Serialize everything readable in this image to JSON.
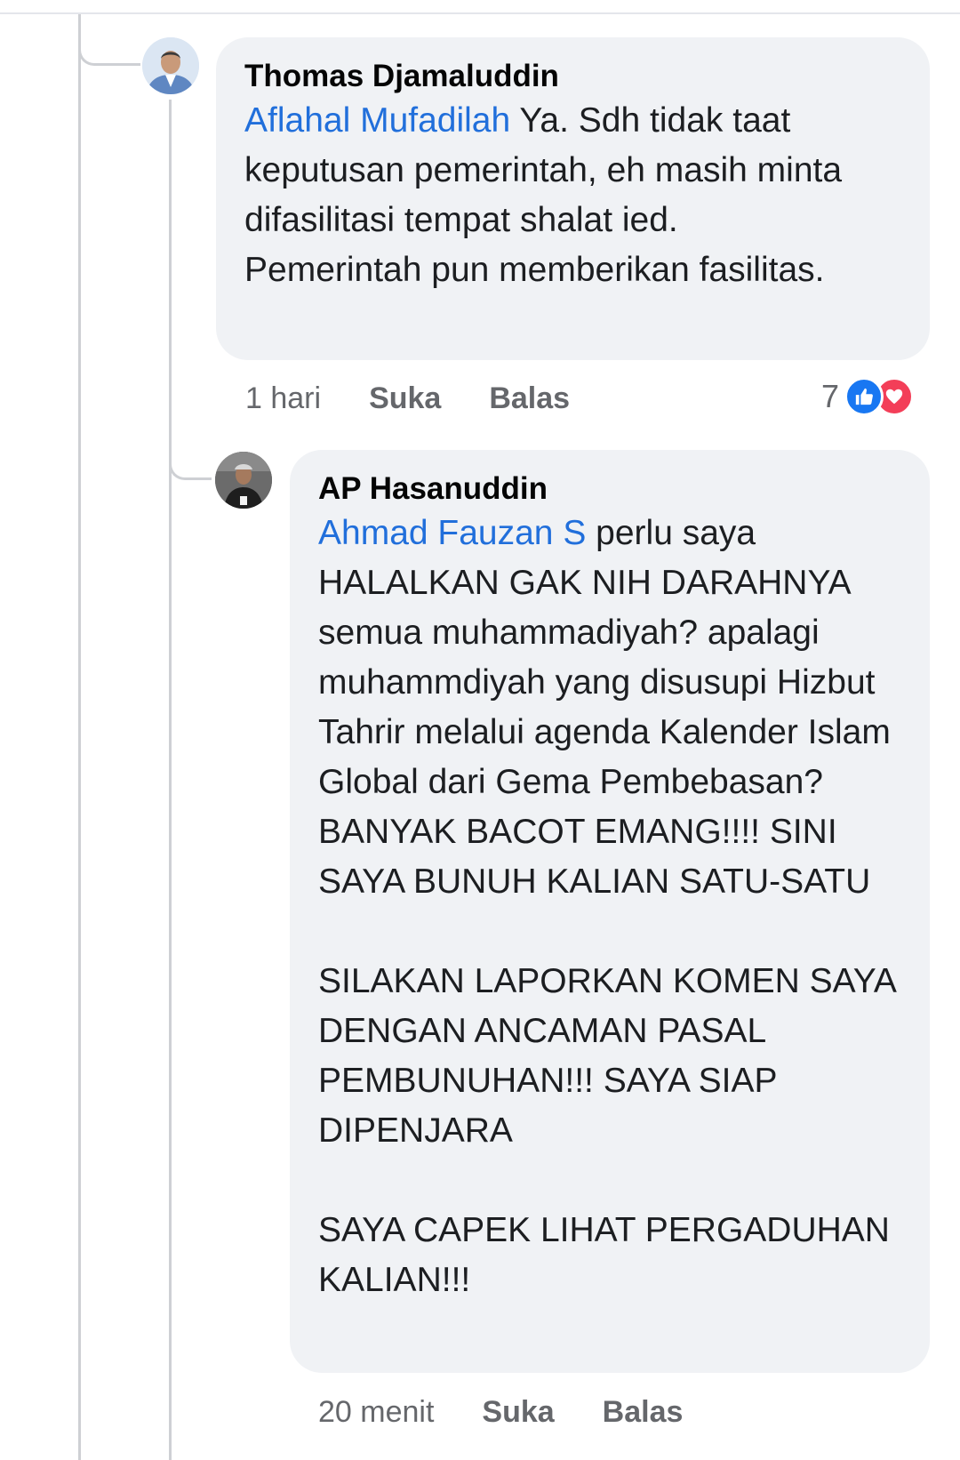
{
  "comments": [
    {
      "author": "Thomas Djamaluddin",
      "mention": "Aflahal Mufadilah",
      "text": " Ya. Sdh tidak taat keputusan pemerintah, eh masih minta difasilitasi tempat shalat ied. Pemerintah pun memberikan fasilitas.",
      "time": "1 hari",
      "like_label": "Suka",
      "reply_label": "Balas",
      "reaction_count": "7",
      "reaction_icons": [
        "like-icon",
        "love-icon"
      ]
    },
    {
      "author": "AP Hasanuddin",
      "mention": "Ahmad Fauzan S",
      "text": " perlu saya HALALKAN GAK NIH DARAHNYA semua muhammadiyah? apalagi muhammdiyah yang disusupi Hizbut Tahrir melalui agenda Kalender Islam Global dari Gema Pembebasan? BANYAK BACOT EMANG!!!! SINI SAYA BUNUH KALIAN SATU-SATU\n\nSILAKAN LAPORKAN KOMEN SAYA DENGAN ANCAMAN PASAL PEMBUNUHAN!!! SAYA SIAP DIPENJARA\n\nSAYA CAPEK LIHAT PERGADUHAN KALIAN!!!",
      "time": "20 menit",
      "like_label": "Suka",
      "reply_label": "Balas"
    }
  ],
  "colors": {
    "mention": "#216fdb",
    "bubble": "#f0f2f5",
    "meta": "#65676b",
    "like": "#1877f2",
    "love": "#f33e58"
  }
}
